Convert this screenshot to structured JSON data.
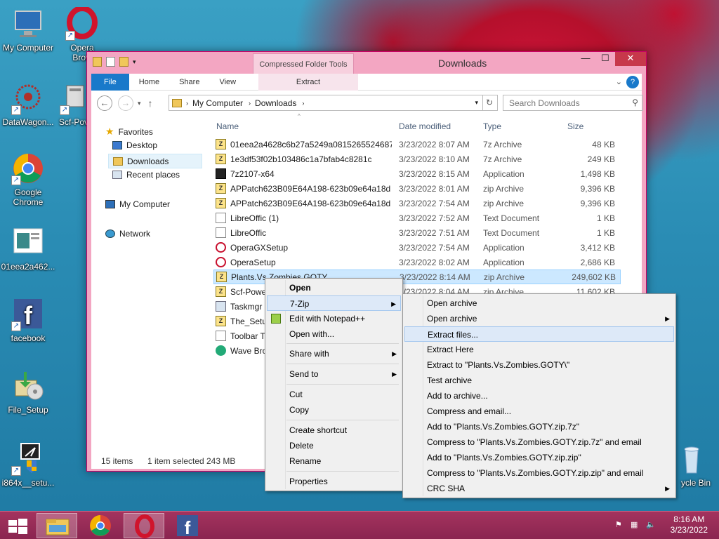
{
  "desktop": {
    "icons": [
      {
        "label": "My Computer"
      },
      {
        "label": "Opera Brow"
      },
      {
        "label": "DataWagon..."
      },
      {
        "label": "Scf-Pov"
      },
      {
        "label": "Google Chrome"
      },
      {
        "label": "01eea2a462..."
      },
      {
        "label": "facebook"
      },
      {
        "label": "File_Setup"
      },
      {
        "label": "i864x__setu..."
      },
      {
        "label": "ycle Bin"
      }
    ]
  },
  "window": {
    "title": "Downloads",
    "context_tab_group": "Compressed Folder Tools",
    "ribbon_tabs": [
      "File",
      "Home",
      "Share",
      "View",
      "Extract"
    ],
    "breadcrumb": [
      "My Computer",
      "Downloads"
    ],
    "search_placeholder": "Search Downloads",
    "nav": {
      "favorites": "Favorites",
      "desktop": "Desktop",
      "downloads": "Downloads",
      "recent": "Recent places",
      "computer": "My Computer",
      "network": "Network"
    },
    "columns": {
      "name": "Name",
      "date": "Date modified",
      "type": "Type",
      "size": "Size"
    },
    "files": [
      {
        "name": "01eea2a4628c6b27a5249a08152655246871...",
        "date": "3/23/2022 8:07 AM",
        "type": "7z Archive",
        "size": "48 KB",
        "icon": "zip"
      },
      {
        "name": "1e3df53f02b103486c1a7bfab4c8281c",
        "date": "3/23/2022 8:10 AM",
        "type": "7z Archive",
        "size": "249 KB",
        "icon": "zip"
      },
      {
        "name": "7z2107-x64",
        "date": "3/23/2022 8:15 AM",
        "type": "Application",
        "size": "1,498 KB",
        "icon": "app"
      },
      {
        "name": "APPatch623B09E64A198-623b09e64a18d ...",
        "date": "3/23/2022 8:01 AM",
        "type": "zip Archive",
        "size": "9,396 KB",
        "icon": "zip"
      },
      {
        "name": "APPatch623B09E64A198-623b09e64a18d",
        "date": "3/23/2022 7:54 AM",
        "type": "zip Archive",
        "size": "9,396 KB",
        "icon": "zip"
      },
      {
        "name": "LibreOffic (1)",
        "date": "3/23/2022 7:52 AM",
        "type": "Text Document",
        "size": "1 KB",
        "icon": "txt"
      },
      {
        "name": "LibreOffic",
        "date": "3/23/2022 7:51 AM",
        "type": "Text Document",
        "size": "1 KB",
        "icon": "txt"
      },
      {
        "name": "OperaGXSetup",
        "date": "3/23/2022 7:54 AM",
        "type": "Application",
        "size": "3,412 KB",
        "icon": "opera"
      },
      {
        "name": "OperaSetup",
        "date": "3/23/2022 8:02 AM",
        "type": "Application",
        "size": "2,686 KB",
        "icon": "opera"
      },
      {
        "name": "Plants.Vs.Zombies.GOTY",
        "date": "3/23/2022 8:14 AM",
        "type": "zip Archive",
        "size": "249,602 KB",
        "icon": "zip",
        "selected": true
      },
      {
        "name": "Scf-Powe",
        "date": "3/23/2022 8:04 AM",
        "type": "zip Archive",
        "size": "11,602 KB",
        "icon": "zip"
      },
      {
        "name": "Taskmgr",
        "date": "",
        "type": "",
        "size": "",
        "icon": "tm"
      },
      {
        "name": "The_Setu",
        "date": "",
        "type": "",
        "size": "",
        "icon": "zip"
      },
      {
        "name": "Toolbar T",
        "date": "",
        "type": "",
        "size": "",
        "icon": "txt"
      },
      {
        "name": "Wave Bro",
        "date": "",
        "type": "",
        "size": "",
        "icon": "wave"
      }
    ],
    "status": {
      "count": "15 items",
      "selected": "1 item selected",
      "size": "243 MB"
    }
  },
  "context_menu": {
    "items": [
      "Open",
      "7-Zip",
      "Edit with Notepad++",
      "Open with...",
      "Share with",
      "Send to",
      "Cut",
      "Copy",
      "Create shortcut",
      "Delete",
      "Rename",
      "Properties"
    ]
  },
  "zip_menu": {
    "items": [
      "Open archive",
      "Open archive",
      "Extract files...",
      "Extract Here",
      "Extract to \"Plants.Vs.Zombies.GOTY\\\"",
      "Test archive",
      "Add to archive...",
      "Compress and email...",
      "Add to \"Plants.Vs.Zombies.GOTY.zip.7z\"",
      "Compress to \"Plants.Vs.Zombies.GOTY.zip.7z\" and email",
      "Add to \"Plants.Vs.Zombies.GOTY.zip.zip\"",
      "Compress to \"Plants.Vs.Zombies.GOTY.zip.zip\" and email",
      "CRC SHA"
    ]
  },
  "taskbar": {
    "time": "8:16 AM",
    "date": "3/23/2022"
  }
}
